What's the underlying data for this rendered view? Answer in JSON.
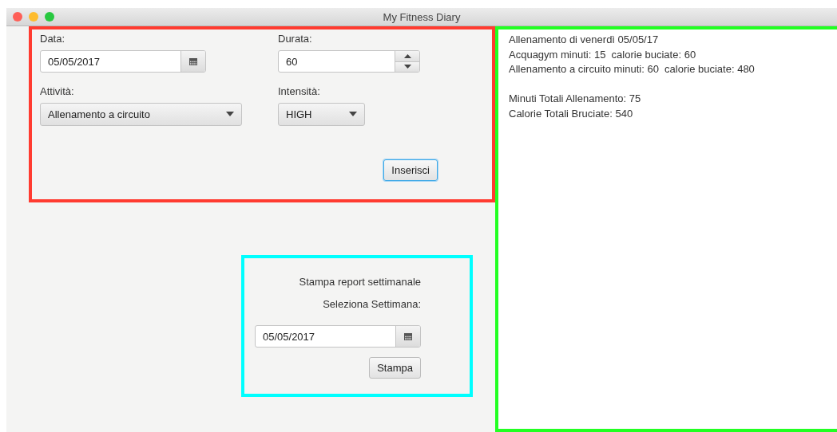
{
  "window": {
    "title": "My Fitness Diary"
  },
  "entry_form": {
    "date": {
      "label": "Data:",
      "value": "05/05/2017"
    },
    "duration": {
      "label": "Durata:",
      "value": "60"
    },
    "activity": {
      "label": "Attività:",
      "value": "Allenamento a circuito"
    },
    "intensity": {
      "label": "Intensità:",
      "value": "HIGH"
    },
    "submit": {
      "label": "Inserisci",
      "focused": true
    }
  },
  "weekly_report": {
    "title": "Stampa report settimanale",
    "week_label": "Seleziona Settimana:",
    "week_date": "05/05/2017",
    "print": {
      "label": "Stampa",
      "focused": false
    }
  },
  "diary_output": {
    "entries": [
      "Allenamento di venerdì 05/05/17",
      "Acquagym minuti: 15  calorie buciate: 60",
      "Allenamento a circuito minuti: 60  calorie buciate: 480"
    ],
    "totals": [
      "Minuti Totali Allenamento: 75",
      "Calorie Totali Bruciate: 540"
    ]
  }
}
